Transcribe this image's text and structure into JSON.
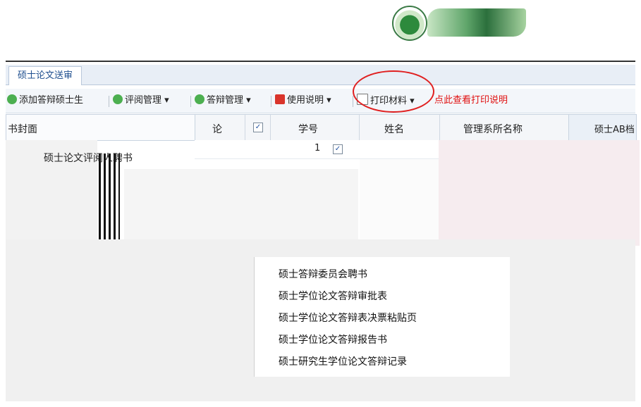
{
  "tab": {
    "label": "硕士论文送审"
  },
  "toolbar": {
    "add_label": "添加答辩硕士生",
    "review_label": "评阅管理",
    "defense_label": "答辩管理",
    "usage_label": "使用说明",
    "print_label": "打印材料",
    "hint_label": "点此查看打印说明"
  },
  "left_panel": {
    "label": "书封面"
  },
  "table": {
    "col_truncated": "论",
    "headers": [
      "学号",
      "姓名",
      "管理系所名称"
    ],
    "row1_num": "1"
  },
  "right_panel": {
    "label": "硕士AB档"
  },
  "print_menu": {
    "items": [
      "硕士论文评阅人聘书",
      "硕士答辩委员会聘书",
      "硕士学位论文答辩审批表",
      "硕士学位论文答辩表决票粘贴页",
      "硕士学位论文答辩报告书",
      "硕士研究生学位论文答辩记录"
    ]
  }
}
